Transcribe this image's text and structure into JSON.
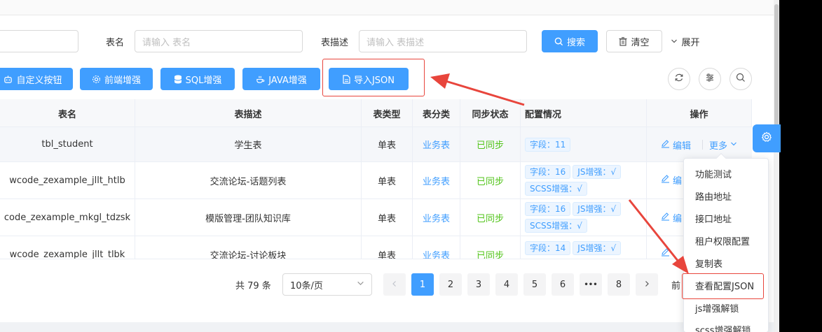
{
  "search": {
    "table_name_label": "表名",
    "table_name_placeholder": "请输入 表名",
    "table_desc_label": "表描述",
    "table_desc_placeholder": "请输入 表描述",
    "search_btn": "搜索",
    "clear_btn": "清空",
    "expand_btn": "展开"
  },
  "toolbar": {
    "custom_btn": "自定义按钮",
    "frontend_btn": "前端增强",
    "sql_btn": "SQL增强",
    "java_btn": "JAVA增强",
    "import_json_btn": "导入JSON"
  },
  "table": {
    "headers": {
      "name": "表名",
      "desc": "表描述",
      "type": "表类型",
      "category": "表分类",
      "sync": "同步状态",
      "config": "配置情况",
      "ops": "操作"
    },
    "rows": [
      {
        "name": "tbl_student",
        "desc": "学生表",
        "type": "单表",
        "category": "业务表",
        "sync": "已同步",
        "tags": [
          "字段：11"
        ]
      },
      {
        "name": "wcode_zexample_jllt_htlb",
        "desc": "交流论坛-话题列表",
        "type": "单表",
        "category": "业务表",
        "sync": "已同步",
        "tags": [
          "字段：16",
          "JS增强：√",
          "SCSS增强：√"
        ]
      },
      {
        "name": "code_zexample_mkgl_tdzsk",
        "desc": "模版管理-团队知识库",
        "type": "单表",
        "category": "业务表",
        "sync": "已同步",
        "tags": [
          "字段：16",
          "JS增强：√",
          "SCSS增强：√"
        ]
      },
      {
        "name": "wcode_zexample_jllt_tlbk",
        "desc": "交流论坛-讨论板块",
        "type": "单表",
        "category": "业务表",
        "sync": "已同步",
        "tags": [
          "字段：14",
          "JS增强：√"
        ]
      }
    ],
    "edit_label": "编辑",
    "edit_label_short": "编",
    "more_label": "更多"
  },
  "dropdown": {
    "items": [
      "功能测试",
      "路由地址",
      "接口地址",
      "租户权限配置",
      "复制表",
      "查看配置JSON",
      "js增强解锁",
      "scss增强解锁"
    ]
  },
  "pagination": {
    "total": "共 79 条",
    "page_size": "10条/页",
    "pages": [
      "1",
      "2",
      "3",
      "4",
      "5",
      "6",
      "8"
    ],
    "ellipsis": "•••",
    "goto_prefix": "前"
  },
  "colors": {
    "primary": "#409eff",
    "success": "#52c41a",
    "highlight_box": "#e8453c"
  }
}
